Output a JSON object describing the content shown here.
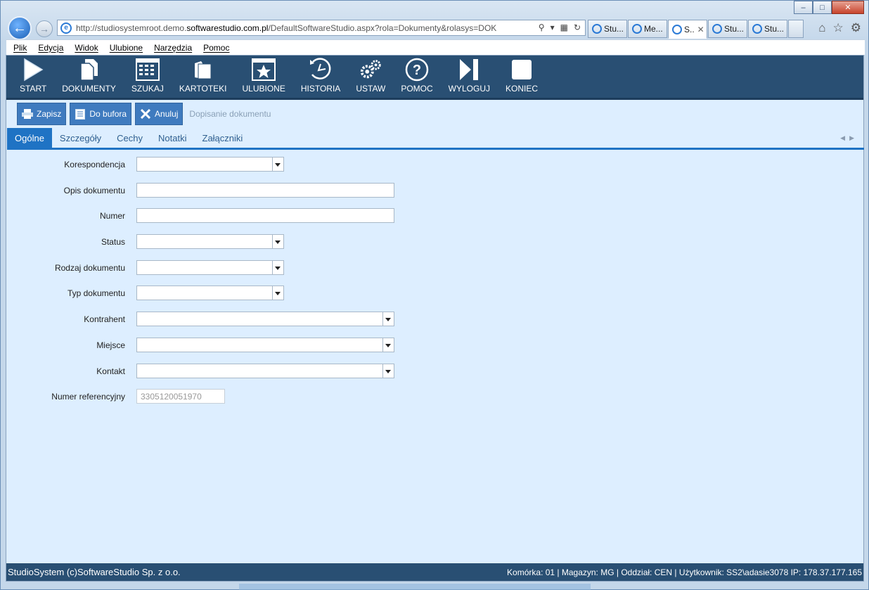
{
  "browser": {
    "url_prefix": "http://studiosystemroot.demo.",
    "url_host": "softwarestudio.com.pl",
    "url_path": "/DefaultSoftwareStudio.aspx?rola=Dokumenty&rolasys=DOK",
    "tabs": [
      {
        "label": "Stu...",
        "active": false
      },
      {
        "label": "Me...",
        "active": false
      },
      {
        "label": "S..",
        "active": true
      },
      {
        "label": "Stu...",
        "active": false
      },
      {
        "label": "Stu...",
        "active": false
      }
    ]
  },
  "menu": [
    "Plik",
    "Edycja",
    "Widok",
    "Ulubione",
    "Narzędzia",
    "Pomoc"
  ],
  "toolbar": [
    {
      "label": "START",
      "icon": "play-icon"
    },
    {
      "label": "DOKUMENTY",
      "icon": "documents-icon"
    },
    {
      "label": "SZUKAJ",
      "icon": "search-grid-icon"
    },
    {
      "label": "KARTOTEKI",
      "icon": "folder-icon"
    },
    {
      "label": "ULUBIONE",
      "icon": "star-window-icon"
    },
    {
      "label": "HISTORIA",
      "icon": "history-icon"
    },
    {
      "label": "USTAW",
      "icon": "gears-icon"
    },
    {
      "label": "POMOC",
      "icon": "help-icon"
    },
    {
      "label": "WYLOGUJ",
      "icon": "logout-icon"
    },
    {
      "label": "KONIEC",
      "icon": "stop-icon"
    }
  ],
  "actions": {
    "save": "Zapisz",
    "buffer": "Do bufora",
    "cancel": "Anuluj",
    "title": "Dopisanie dokumentu"
  },
  "form_tabs": [
    {
      "label": "Ogólne",
      "active": true
    },
    {
      "label": "Szczegóły",
      "active": false
    },
    {
      "label": "Cechy",
      "active": false
    },
    {
      "label": "Notatki",
      "active": false
    },
    {
      "label": "Załączniki",
      "active": false
    }
  ],
  "form": {
    "korespondencja": "Korespondencja",
    "opis": "Opis dokumentu",
    "numer": "Numer",
    "status": "Status",
    "rodzaj": "Rodzaj dokumentu",
    "typ": "Typ dokumentu",
    "kontrahent": "Kontrahent",
    "miejsce": "Miejsce",
    "kontakt": "Kontakt",
    "numer_ref": "Numer referencyjny",
    "numer_ref_value": "3305120051970"
  },
  "status": {
    "left": "StudioSystem (c)SoftwareStudio Sp. z o.o.",
    "right": "Komórka: 01 | Magazyn: MG | Oddział: CEN | Użytkownik: SS2\\adasie3078 IP: 178.37.177.165"
  }
}
